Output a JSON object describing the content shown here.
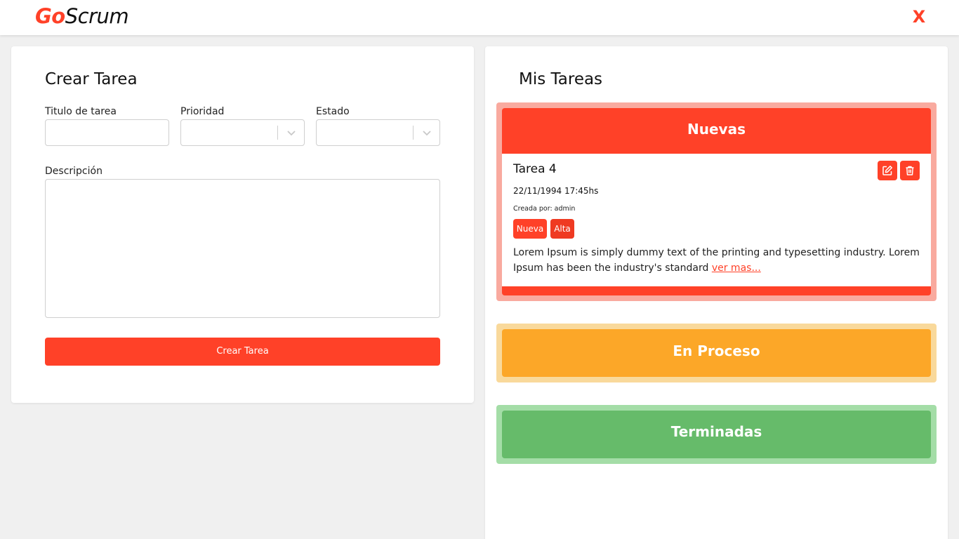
{
  "header": {
    "logo_part1": "Go",
    "logo_part2": "Scrum",
    "close_label": "X"
  },
  "create_form": {
    "title": "Crear Tarea",
    "title_label": "Titulo de tarea",
    "title_value": "",
    "priority_label": "Prioridad",
    "priority_value": "",
    "status_label": "Estado",
    "status_value": "",
    "description_label": "Descripción",
    "description_value": "",
    "submit_label": "Crear Tarea"
  },
  "tasks_panel": {
    "title": "Mis Tareas",
    "groups": [
      {
        "name": "Nuevas",
        "color": "#ff4128",
        "tasks": [
          {
            "title": "Tarea 4",
            "date": "22/11/1994 17:45hs",
            "author": "Creada por: admin",
            "status_tag": "Nueva",
            "priority_tag": "Alta",
            "description": "Lorem Ipsum is simply dummy text of the printing and typesetting industry. Lorem Ipsum has been the industry's standard",
            "more_link": "ver mas..."
          }
        ]
      },
      {
        "name": "En Proceso",
        "color": "#fca728",
        "tasks": []
      },
      {
        "name": "Terminadas",
        "color": "#66bb6a",
        "tasks": []
      }
    ]
  },
  "icons": {
    "edit": "edit-icon",
    "delete": "trash-icon",
    "select_chevron": "chevron-down-icon"
  }
}
